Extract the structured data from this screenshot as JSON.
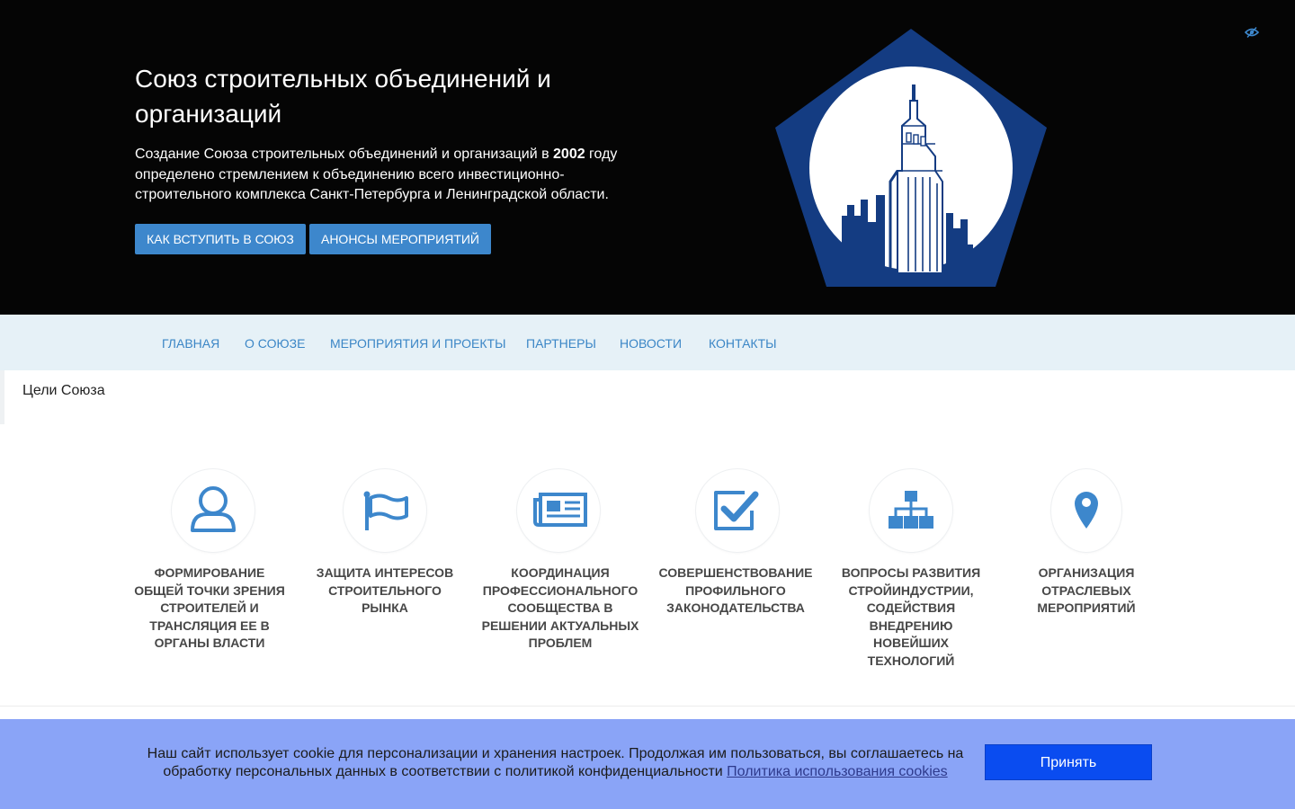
{
  "hero": {
    "title": "Союз строительных объединений и организаций",
    "text_before": "Создание Союза строительных объединений и организаций в ",
    "text_year": "2002",
    "text_after": " году определено стремлением к объединению всего инвестиционно-строительного комплекса Санкт-Петербурга и Ленинградской области.",
    "buttons": {
      "join": "КАК ВСТУПИТЬ В СОЮЗ",
      "events": "АНОНСЫ МЕРОПРИЯТИЙ"
    },
    "logo_icon": "building-pentagon-logo",
    "accessibility_icon": "eye-icon"
  },
  "nav": {
    "items": [
      {
        "label": "ГЛАВНАЯ"
      },
      {
        "label": "О СОЮЗЕ"
      },
      {
        "label": "МЕРОПРИЯТИЯ И ПРОЕКТЫ"
      },
      {
        "label": "ПАРТНЕРЫ"
      },
      {
        "label": "НОВОСТИ"
      },
      {
        "label": "КОНТАКТЫ"
      }
    ]
  },
  "goals": {
    "title": "Цели Союза",
    "items": [
      {
        "icon": "user-icon",
        "label": "Формирование общей точки зрения строителей и трансляция ее в органы власти"
      },
      {
        "icon": "flag-icon",
        "label": "Защита интересов строительного рынка"
      },
      {
        "icon": "newspaper-icon",
        "label": "Координация профессионального сообщества в решении актуальных проблем"
      },
      {
        "icon": "checkbox-icon",
        "label": "Совершенствование профильного законодательства"
      },
      {
        "icon": "sitemap-icon",
        "label": "Вопросы развития стройиндустрии, содействия внедрению новейших технологий"
      },
      {
        "icon": "map-marker-icon",
        "label": "Организация отраслевых мероприятий"
      }
    ]
  },
  "cookie": {
    "text": "Наш сайт использует cookie для персонализации и хранения настроек. Продолжая им пользоваться, вы соглашаетесь на обработку персональных данных в соответствии с политикой конфиденциальности",
    "link": "Политика использования cookies",
    "accept": "Принять"
  },
  "colors": {
    "accent": "#3d87cc",
    "logo_blue": "#143c82",
    "nav_bg": "#e6f1f7",
    "cookie_bg": "#8aa4f7",
    "cookie_button": "#0a4cf0"
  }
}
